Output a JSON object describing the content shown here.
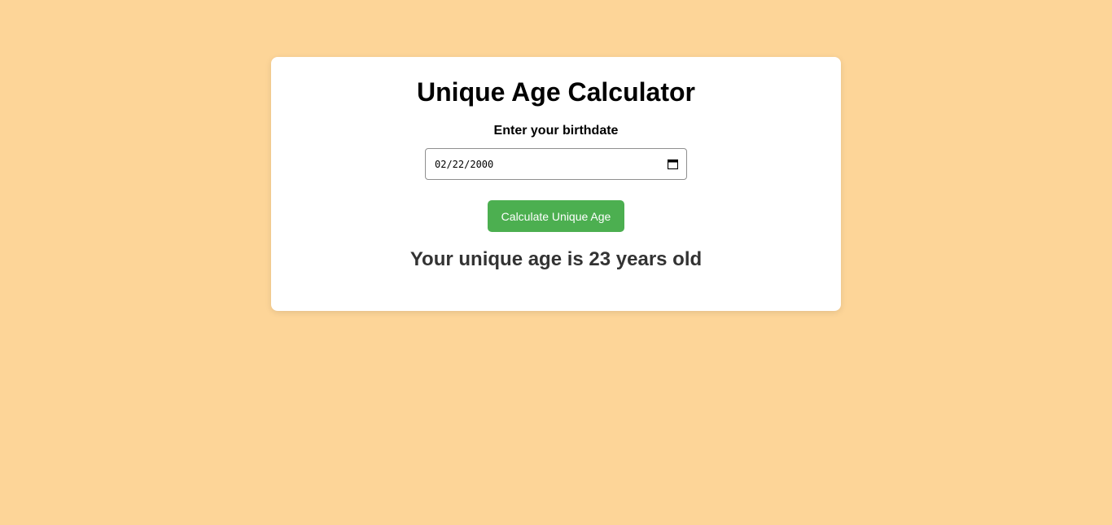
{
  "app": {
    "title": "Unique Age Calculator"
  },
  "form": {
    "birthdate_label": "Enter your birthdate",
    "birthdate_value": "02/22/2000",
    "calendar_icon": "calendar-icon",
    "submit_label": "Calculate Unique Age"
  },
  "result": {
    "text": "Your unique age is 23 years old"
  },
  "colors": {
    "page_background": "#fdd598",
    "card_background": "#ffffff",
    "button_background": "#4caf50",
    "button_text": "#ffffff",
    "result_text": "#333333"
  }
}
